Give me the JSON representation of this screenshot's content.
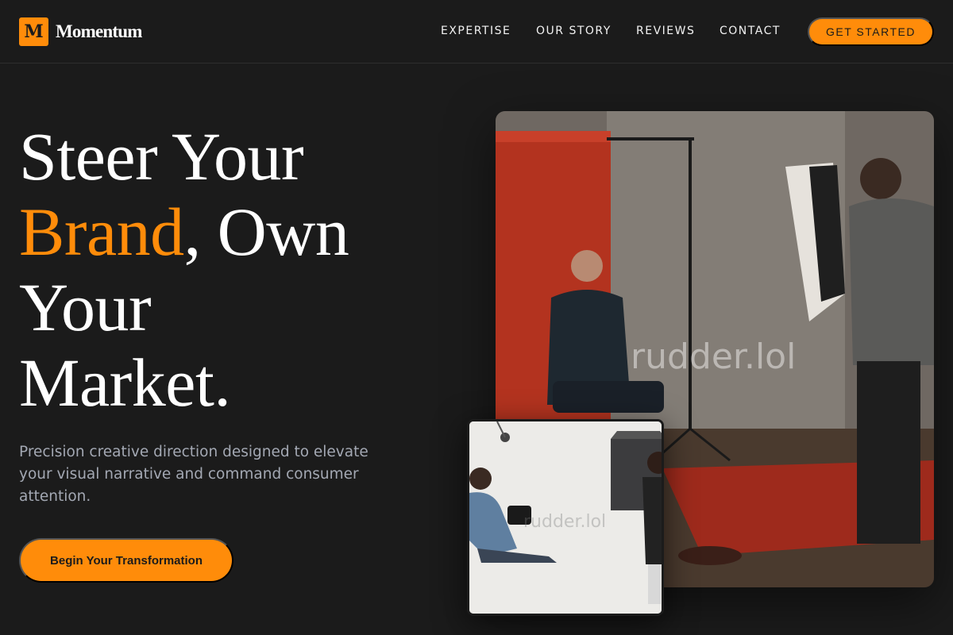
{
  "brand": {
    "mark": "M",
    "name": "Momentum"
  },
  "nav": {
    "links": [
      "EXPERTISE",
      "OUR STORY",
      "REVIEWS",
      "CONTACT"
    ],
    "cta": "GET STARTED"
  },
  "hero": {
    "line1": "Steer Your",
    "accent_word": "Brand",
    "line2_rest": ", Own",
    "line3": "Your",
    "line4": "Market.",
    "subtitle": "Precision creative direction designed to elevate your visual narrative and command consumer attention.",
    "cta": "Begin Your Transformation"
  },
  "media": {
    "main_watermark": "rudder.lol",
    "small_watermark": "rudder.lol"
  },
  "colors": {
    "accent": "#ff8c0a",
    "background": "#1b1b1b",
    "subtitle": "#a3a8b3"
  }
}
